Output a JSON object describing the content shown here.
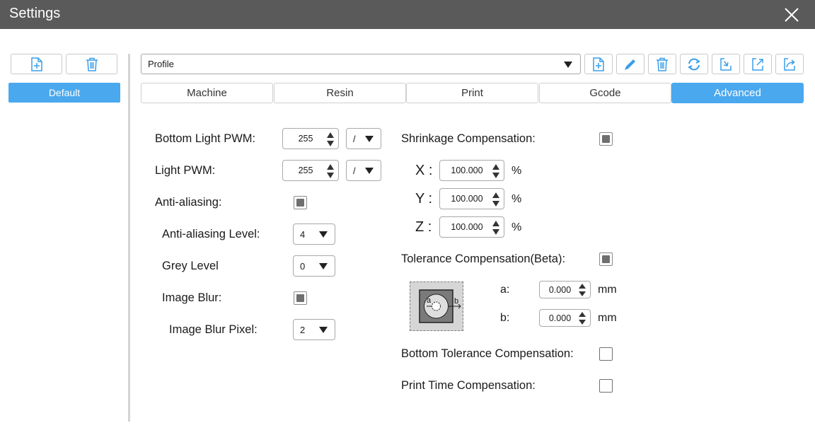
{
  "window": {
    "title": "Settings"
  },
  "sidebar": {
    "add_icon": "file-plus-icon",
    "delete_icon": "trash-icon",
    "items": [
      {
        "label": "Default",
        "selected": true
      }
    ]
  },
  "profile": {
    "selected": "Profile"
  },
  "toolbar": {
    "icons": [
      "file-plus-icon",
      "pencil-icon",
      "trash-icon",
      "refresh-icon",
      "import-icon",
      "export-icon",
      "share-icon"
    ]
  },
  "tabs": [
    {
      "label": "Machine",
      "active": false
    },
    {
      "label": "Resin",
      "active": false
    },
    {
      "label": "Print",
      "active": false
    },
    {
      "label": "Gcode",
      "active": false
    },
    {
      "label": "Advanced",
      "active": true
    }
  ],
  "left": {
    "bottom_light_pwm": {
      "label": "Bottom Light PWM:",
      "value": "255",
      "mode": "/"
    },
    "light_pwm": {
      "label": "Light PWM:",
      "value": "255",
      "mode": "/"
    },
    "anti_aliasing": {
      "label": "Anti-aliasing:",
      "checked": true
    },
    "anti_aliasing_level": {
      "label": "Anti-aliasing Level:",
      "value": "4"
    },
    "grey_level": {
      "label": "Grey Level",
      "value": "0"
    },
    "image_blur": {
      "label": "Image Blur:",
      "checked": true
    },
    "image_blur_pixel": {
      "label": "Image Blur Pixel:",
      "value": "2"
    }
  },
  "right": {
    "shrinkage": {
      "label": "Shrinkage Compensation:",
      "checked": true,
      "x": {
        "label": "X :",
        "value": "100.000",
        "unit": "%"
      },
      "y": {
        "label": "Y :",
        "value": "100.000",
        "unit": "%"
      },
      "z": {
        "label": "Z :",
        "value": "100.000",
        "unit": "%"
      }
    },
    "tolerance": {
      "label": "Tolerance Compensation(Beta):",
      "checked": true,
      "diagram_a": "a",
      "diagram_b": "b",
      "a": {
        "label": "a:",
        "value": "0.000",
        "unit": "mm"
      },
      "b": {
        "label": "b:",
        "value": "0.000",
        "unit": "mm"
      }
    },
    "bottom_tolerance": {
      "label": "Bottom Tolerance Compensation:",
      "checked": false
    },
    "print_time": {
      "label": "Print Time Compensation:",
      "checked": false
    }
  },
  "colors": {
    "accent": "#4aa8ee",
    "titlebar": "#5a5a5a",
    "icon": "#3a9ee8"
  }
}
